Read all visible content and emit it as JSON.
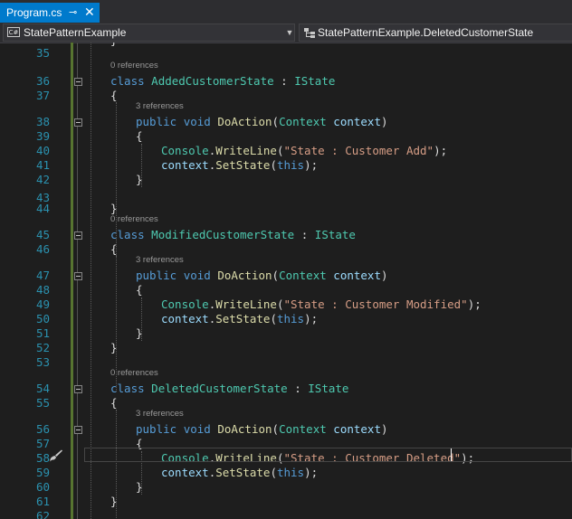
{
  "tab": {
    "title": "Program.cs",
    "pin_glyph": "⊸",
    "close_glyph": "✕"
  },
  "navigation": {
    "project_icon_text": "C#",
    "project": "StatePatternExample",
    "member": "StatePatternExample.DeletedCustomerState"
  },
  "editor": {
    "top_partial_line": "}",
    "lines": [
      {
        "n": "35"
      },
      {
        "n": "36",
        "lens": "0 references",
        "code": "class AddedCustomerState : IState"
      },
      {
        "n": "37",
        "code": "{"
      },
      {
        "n": "38",
        "lens": "3 references",
        "code": "public void DoAction(Context context)"
      },
      {
        "n": "39",
        "code": "{"
      },
      {
        "n": "40",
        "code": "Console.WriteLine(\"State : Customer Add\");"
      },
      {
        "n": "41",
        "code": "context.SetState(this);"
      },
      {
        "n": "42",
        "code": "}"
      },
      {
        "n": "43"
      },
      {
        "n": "44",
        "code": "}"
      },
      {
        "n": "45",
        "lens": "0 references",
        "code": "class ModifiedCustomerState : IState"
      },
      {
        "n": "46",
        "code": "{"
      },
      {
        "n": "47",
        "lens": "3 references",
        "code": "public void DoAction(Context context)"
      },
      {
        "n": "48",
        "code": "{"
      },
      {
        "n": "49",
        "code": "Console.WriteLine(\"State : Customer Modified\");"
      },
      {
        "n": "50",
        "code": "context.SetState(this);"
      },
      {
        "n": "51",
        "code": "}"
      },
      {
        "n": "52",
        "code": "}"
      },
      {
        "n": "53"
      },
      {
        "n": "54",
        "lens": "0 references",
        "code": "class DeletedCustomerState : IState"
      },
      {
        "n": "55",
        "code": "{"
      },
      {
        "n": "56",
        "lens": "3 references",
        "code": "public void DoAction(Context context)"
      },
      {
        "n": "57",
        "code": "{"
      },
      {
        "n": "58",
        "code": "Console.WriteLine(\"State : Customer Deleted\");"
      },
      {
        "n": "59",
        "code": "context.SetState(this);"
      },
      {
        "n": "60",
        "code": "}"
      },
      {
        "n": "61",
        "code": "}"
      },
      {
        "n": "62"
      }
    ]
  },
  "gutter": {
    "quick_action_icon": "paintbrush-icon"
  },
  "colors": {
    "keyword": "#569cd6",
    "type": "#4ec9b0",
    "method": "#dcdcaa",
    "string": "#d69d85",
    "parameter": "#9cdcfe",
    "line_number": "#2b91af",
    "tab_active": "#007acc",
    "change_bar": "#577430"
  }
}
